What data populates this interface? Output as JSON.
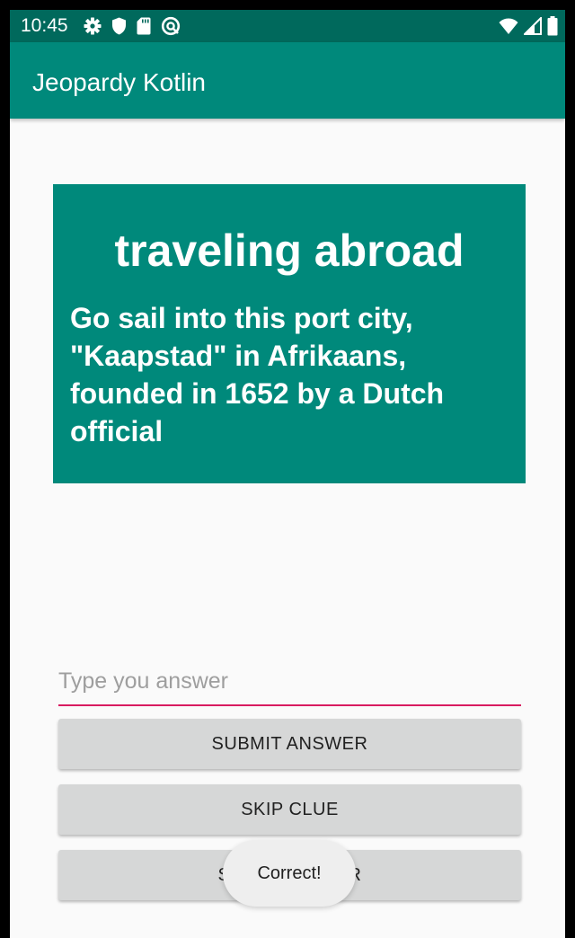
{
  "status_bar": {
    "time": "10:45",
    "left_icons": [
      "gear-icon",
      "shield-icon",
      "sd-card-icon",
      "sync-blocked-icon"
    ],
    "right_icons": [
      "wifi-icon",
      "cellular-signal-icon",
      "battery-icon"
    ],
    "background_color": "#00695c"
  },
  "app_bar": {
    "title": "Jeopardy Kotlin",
    "background_color": "#00897b"
  },
  "clue": {
    "category": "traveling abroad",
    "question": "Go sail into this port city, \"Kaapstad\" in Afrikaans, founded in 1652 by a Dutch official",
    "background_color": "#00897b"
  },
  "answer_input": {
    "placeholder": "Type you answer",
    "value": "",
    "underline_color": "#d81b60"
  },
  "buttons": {
    "submit": "SUBMIT ANSWER",
    "skip": "SKIP CLUE",
    "show": "SHOW ANSWER"
  },
  "toast": {
    "message": "Correct!"
  }
}
